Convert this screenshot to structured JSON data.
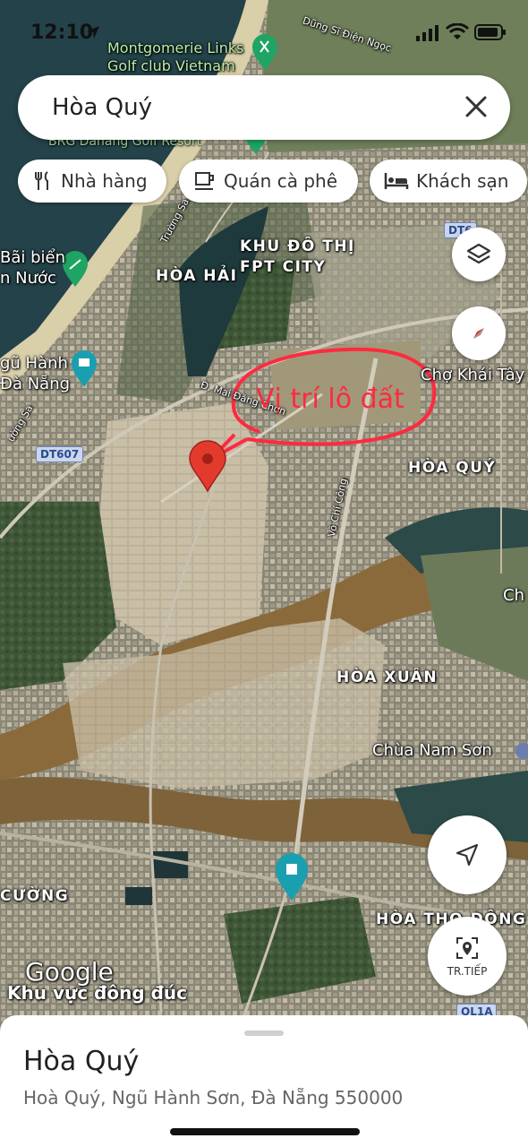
{
  "status": {
    "time": "12:10"
  },
  "search": {
    "query": "Hòa Quý"
  },
  "chips": [
    {
      "label": "Nhà hàng",
      "icon": "restaurant-icon"
    },
    {
      "label": "Quán cà phê",
      "icon": "coffee-icon"
    },
    {
      "label": "Khách sạn",
      "icon": "hotel-icon"
    }
  ],
  "map": {
    "annotation": "Vị trí lô đất",
    "labels": {
      "montgomerie": "Montgomerie Links\nGolf club Vietnam",
      "brg": "BRG Danang Golf Resort",
      "dung_si": "Dũng Sĩ Điện Ngọc",
      "fpt": "KHU ĐÔ THỊ\nFPT CITY",
      "hoa_hai": "HÒA HẢI",
      "bai_bien": "Bãi biển\nn Nước",
      "ngu_hanh": "gũ Hành\nĐà Nẵng",
      "cho_khai_tay": "Chợ Khái Tây",
      "hoa_quy": "HÒA QUÝ",
      "truong_sa_1": "Trường Sa",
      "truong_sa_2": "ường Sa",
      "mai_dang_chon": "Đ. Mai Đăng Chơn",
      "vo_chi_cong": "Võ Chí Công",
      "dt607": "DT607",
      "dt6": "DT6",
      "ch": "Ch",
      "hoa_xuan": "HÒA XUÂN",
      "chua_nam_son": "Chùa Nam Sơn",
      "cuong": "CƯỜNG",
      "hoa_tho_dong": "HÒA THỌ ĐÔNG",
      "ql1a": "QL1A",
      "google": "Google",
      "busy_area": "Khu vực đông đúc"
    }
  },
  "controls": {
    "street_view_label": "TR.TIẾP"
  },
  "place": {
    "title": "Hòa Quý",
    "address": "Hoà Quý, Ngũ Hành Sơn, Đà Nẵng 550000"
  },
  "colors": {
    "annotation_red": "#ff2a3f",
    "pin_red": "#e23b2e",
    "water": "#2c4a4f",
    "river": "#8a6a3a",
    "teal_poi": "#1a9fb0",
    "green_poi": "#1fa463"
  }
}
